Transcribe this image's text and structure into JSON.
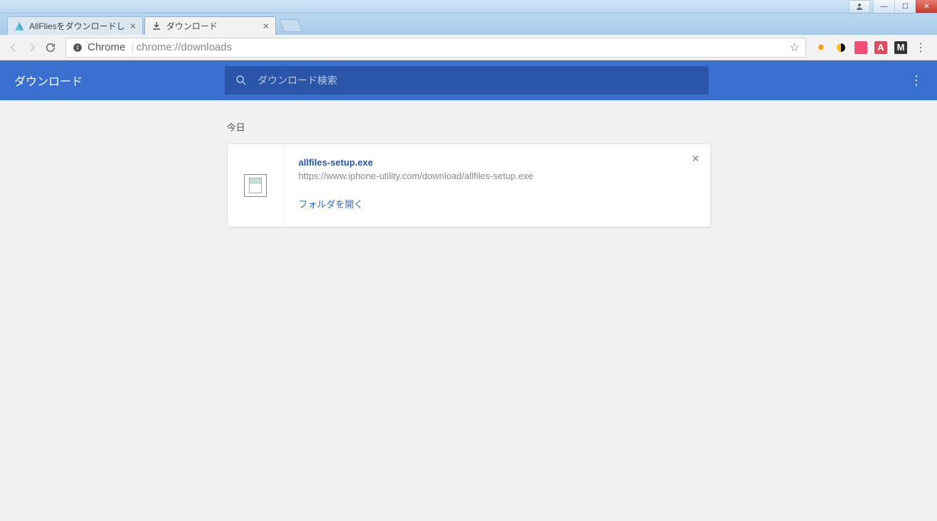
{
  "window_controls": {
    "minimize_glyph": "—",
    "maximize_glyph": "☐",
    "close_glyph": "✕",
    "user_glyph": "👤"
  },
  "tabs": [
    {
      "title": "AllFliesをダウンロードし",
      "favicon_color1": "#66c6e0",
      "favicon_color2": "#3a9bd8",
      "active": false
    },
    {
      "title": "ダウンロード",
      "favicon_glyph": "download",
      "active": true
    }
  ],
  "omnibox": {
    "label": "Chrome",
    "path": "chrome://downloads"
  },
  "extensions": [
    {
      "name": "ext-1",
      "bg": "transparent",
      "color": "#f59e0b",
      "glyph": "✸"
    },
    {
      "name": "ext-2",
      "bg": "transparent",
      "color": "#111",
      "glyph": "◑"
    },
    {
      "name": "ext-3",
      "bg": "#ef4f73",
      "color": "#fff",
      "glyph": " "
    },
    {
      "name": "ext-4",
      "bg": "#e04a5a",
      "color": "#fff",
      "glyph": "A"
    },
    {
      "name": "ext-5",
      "bg": "#333",
      "color": "#fff",
      "glyph": "M"
    }
  ],
  "page_header": {
    "title": "ダウンロード",
    "search_placeholder": "ダウンロード検索"
  },
  "downloads": {
    "date_label": "今日",
    "items": [
      {
        "filename": "allfiles-setup.exe",
        "url": "https://www.iphone-utility.com/download/allfiles-setup.exe",
        "action": "フォルダを開く"
      }
    ]
  }
}
